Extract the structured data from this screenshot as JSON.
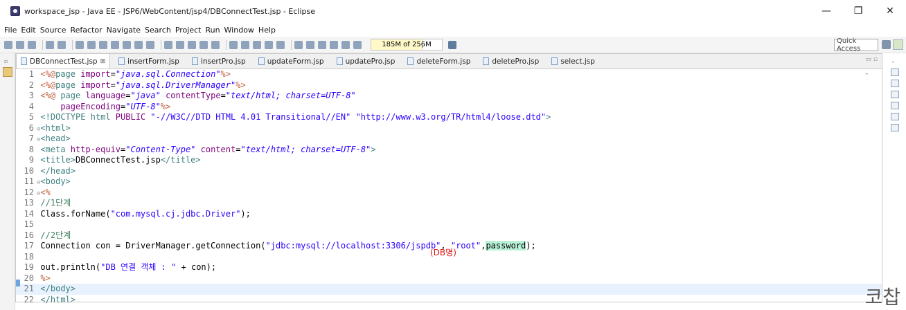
{
  "window": {
    "title": "workspace_jsp - Java EE - JSP6/WebContent/jsp4/DBConnectTest.jsp - Eclipse",
    "controls": [
      "—",
      "❐",
      "✕"
    ]
  },
  "menu": [
    "File",
    "Edit",
    "Source",
    "Refactor",
    "Navigate",
    "Search",
    "Project",
    "Run",
    "Window",
    "Help"
  ],
  "toolbar": {
    "heap_status": "185M of 256M",
    "quick_access": "Quick Access"
  },
  "tabs": [
    {
      "label": "DBConnectTest.jsp",
      "active": true,
      "close": "⊠"
    },
    {
      "label": "insertForm.jsp"
    },
    {
      "label": "insertPro.jsp"
    },
    {
      "label": "updateForm.jsp"
    },
    {
      "label": "updatePro.jsp"
    },
    {
      "label": "deleteForm.jsp"
    },
    {
      "label": "deletePro.jsp"
    },
    {
      "label": "select.jsp"
    }
  ],
  "code_lines": [
    {
      "n": "1",
      "parts": [
        [
          "k-jsp",
          "<%@"
        ],
        [
          "k-tag",
          "page "
        ],
        [
          "k-attr",
          "import"
        ],
        [
          "k-plain",
          "="
        ],
        [
          "k-val",
          "\"java.sql.Connection\""
        ],
        [
          "k-jsp",
          "%>"
        ]
      ]
    },
    {
      "n": "2",
      "parts": [
        [
          "k-jsp",
          "<%@"
        ],
        [
          "k-tag",
          "page "
        ],
        [
          "k-attr",
          "import"
        ],
        [
          "k-plain",
          "="
        ],
        [
          "k-val",
          "\"java.sql.DriverManager\""
        ],
        [
          "k-jsp",
          "%>"
        ]
      ]
    },
    {
      "n": "3",
      "parts": [
        [
          "k-jsp",
          "<%@ "
        ],
        [
          "k-tag",
          "page "
        ],
        [
          "k-attr",
          "language"
        ],
        [
          "k-plain",
          "="
        ],
        [
          "k-val",
          "\"java\""
        ],
        [
          "k-plain",
          " "
        ],
        [
          "k-attr",
          "contentType"
        ],
        [
          "k-plain",
          "="
        ],
        [
          "k-val",
          "\"text/html; charset=UTF-8\""
        ]
      ]
    },
    {
      "n": "4",
      "parts": [
        [
          "k-plain",
          "    "
        ],
        [
          "k-attr",
          "pageEncoding"
        ],
        [
          "k-plain",
          "="
        ],
        [
          "k-val",
          "\"UTF-8\""
        ],
        [
          "k-jsp",
          "%>"
        ]
      ]
    },
    {
      "n": "5",
      "parts": [
        [
          "k-tag",
          "<!DOCTYPE "
        ],
        [
          "k-tag",
          "html "
        ],
        [
          "k-attr",
          "PUBLIC "
        ],
        [
          "k-str",
          "\"-//W3C//DTD HTML 4.01 Transitional//EN\" \"http://www.w3.org/TR/html4/loose.dtd\""
        ],
        [
          "k-tag",
          ">"
        ]
      ]
    },
    {
      "n": "6",
      "fold": "⊖",
      "parts": [
        [
          "k-tag",
          "<html>"
        ]
      ]
    },
    {
      "n": "7",
      "fold": "⊖",
      "parts": [
        [
          "k-tag",
          "<head>"
        ]
      ]
    },
    {
      "n": "8",
      "parts": [
        [
          "k-tag",
          "<meta "
        ],
        [
          "k-attr",
          "http-equiv"
        ],
        [
          "k-plain",
          "="
        ],
        [
          "k-val",
          "\"Content-Type\""
        ],
        [
          "k-plain",
          " "
        ],
        [
          "k-attr",
          "content"
        ],
        [
          "k-plain",
          "="
        ],
        [
          "k-val",
          "\"text/html; charset=UTF-8\""
        ],
        [
          "k-tag",
          ">"
        ]
      ]
    },
    {
      "n": "9",
      "parts": [
        [
          "k-tag",
          "<title>"
        ],
        [
          "k-plain",
          "DBConnectTest.jsp"
        ],
        [
          "k-tag",
          "</title>"
        ]
      ]
    },
    {
      "n": "10",
      "parts": [
        [
          "k-tag",
          "</head>"
        ]
      ]
    },
    {
      "n": "11",
      "fold": "⊖",
      "parts": [
        [
          "k-tag",
          "<body>"
        ]
      ]
    },
    {
      "n": "12",
      "fold": "⊖",
      "parts": [
        [
          "k-jsp",
          "<%"
        ]
      ]
    },
    {
      "n": "13",
      "parts": [
        [
          "k-com",
          "//1단계"
        ]
      ]
    },
    {
      "n": "14",
      "parts": [
        [
          "k-plain",
          "Class.forName("
        ],
        [
          "k-str",
          "\"com.mysql.cj.jdbc.Driver\""
        ],
        [
          "k-plain",
          ");"
        ]
      ]
    },
    {
      "n": "15",
      "parts": []
    },
    {
      "n": "16",
      "parts": [
        [
          "k-com",
          "//2단계"
        ]
      ]
    },
    {
      "n": "17",
      "parts": [
        [
          "k-plain",
          "Connection con = DriverManager.getConnection("
        ],
        [
          "k-str",
          "\"jdbc:mysql://localhost:3306/jspdb\""
        ],
        [
          "k-plain",
          ", "
        ],
        [
          "k-str",
          "\"root\""
        ],
        [
          "k-plain",
          ","
        ],
        [
          "k-pw",
          "password"
        ],
        [
          "k-plain",
          ");"
        ]
      ]
    },
    {
      "n": "18",
      "parts": []
    },
    {
      "n": "19",
      "parts": [
        [
          "k-plain",
          "out.println("
        ],
        [
          "k-str",
          "\"DB 연결 객체 : \""
        ],
        [
          "k-plain",
          " + con);"
        ]
      ]
    },
    {
      "n": "20",
      "parts": [
        [
          "k-jsp",
          "%>"
        ]
      ]
    },
    {
      "n": "21",
      "current": true,
      "parts": [
        [
          "k-tag",
          "</body>"
        ]
      ]
    },
    {
      "n": "22",
      "parts": [
        [
          "k-tag",
          "</html>"
        ]
      ]
    }
  ],
  "annotation": "(DB명)",
  "watermark": "코찹",
  "colors": {
    "tag": "#3f7f7f",
    "attr": "#7f007f",
    "value": "#2a00ff",
    "jsp": "#bf5f3f",
    "comment": "#3f7f5f",
    "annotation": "#e01212"
  }
}
